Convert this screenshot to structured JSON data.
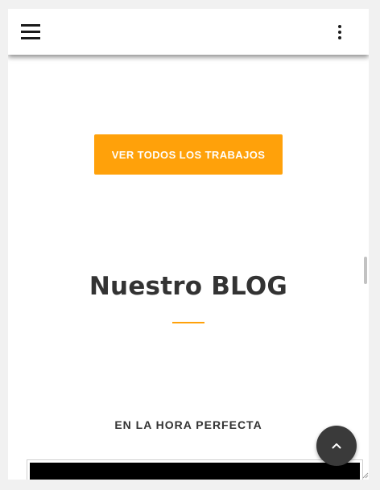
{
  "header": {
    "menu_icon": "hamburger-menu-icon",
    "more_icon": "vertical-ellipsis-icon"
  },
  "work": {
    "view_all_label": "VER TODOS LOS TRABAJOS"
  },
  "blog": {
    "title": "Nuestro BLOG",
    "post_title": "EN LA HORA PERFECTA"
  },
  "fab": {
    "icon": "chevron-up-icon"
  },
  "colors": {
    "accent": "#ffa10a",
    "title_text": "#333333",
    "fab_background": "#3a3a3a"
  }
}
